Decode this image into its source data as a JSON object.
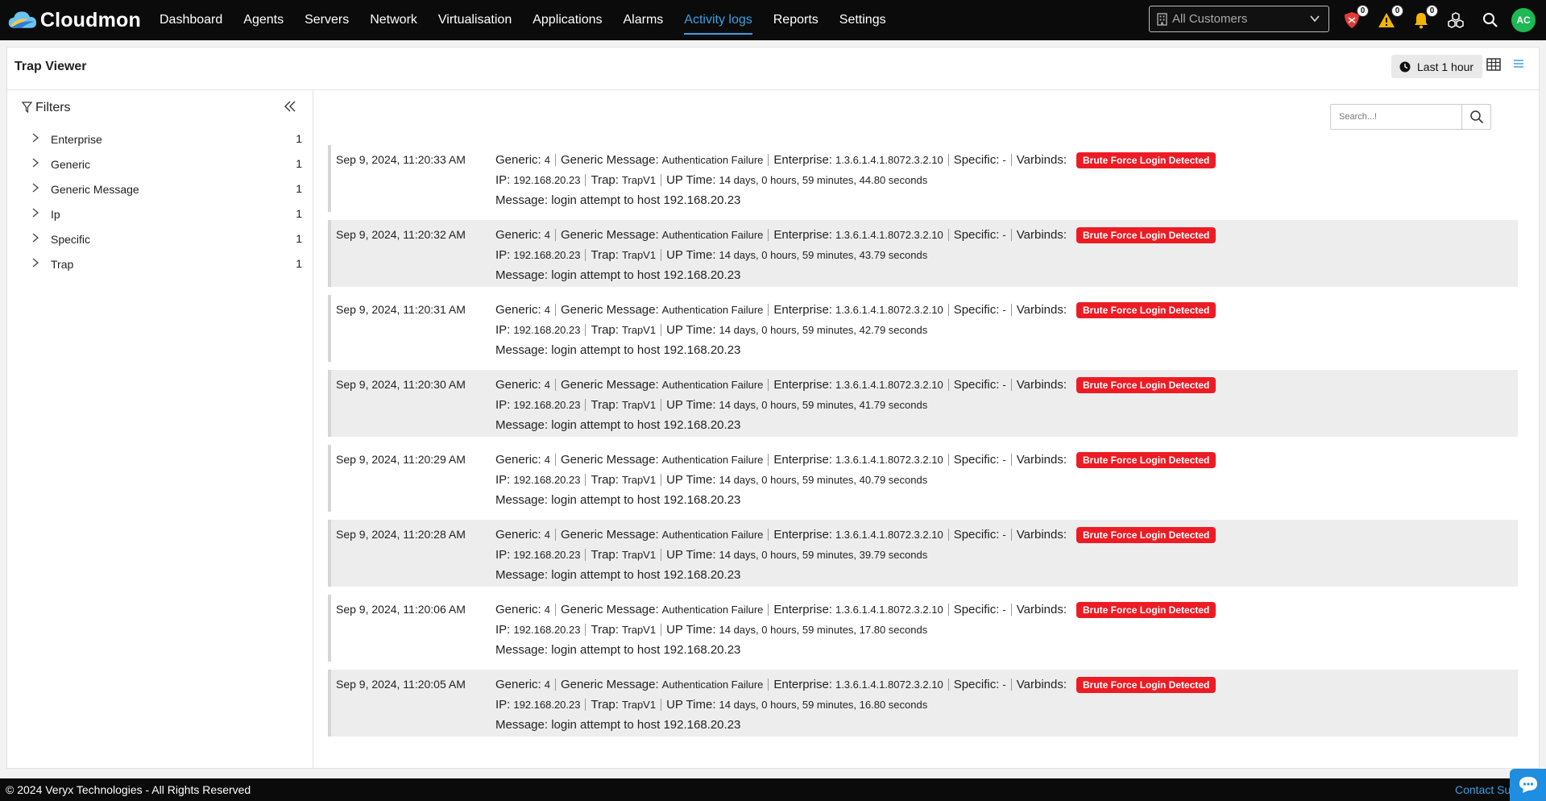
{
  "app": {
    "name": "Cloudmon"
  },
  "nav": [
    {
      "label": "Dashboard",
      "active": false
    },
    {
      "label": "Agents",
      "active": false
    },
    {
      "label": "Servers",
      "active": false
    },
    {
      "label": "Network",
      "active": false
    },
    {
      "label": "Virtualisation",
      "active": false
    },
    {
      "label": "Applications",
      "active": false
    },
    {
      "label": "Alarms",
      "active": false
    },
    {
      "label": "Activity logs",
      "active": true
    },
    {
      "label": "Reports",
      "active": false
    },
    {
      "label": "Settings",
      "active": false
    }
  ],
  "customer_select": {
    "placeholder": "All Customers"
  },
  "badges": {
    "security": "0",
    "warning": "0",
    "notifications": "0"
  },
  "user": {
    "initials": "AC"
  },
  "page": {
    "title": "Trap Viewer",
    "time_range": "Last 1 hour"
  },
  "filters": {
    "title": "Filters",
    "items": [
      {
        "label": "Enterprise",
        "count": "1"
      },
      {
        "label": "Generic",
        "count": "1"
      },
      {
        "label": "Generic Message",
        "count": "1"
      },
      {
        "label": "Ip",
        "count": "1"
      },
      {
        "label": "Specific",
        "count": "1"
      },
      {
        "label": "Trap",
        "count": "1"
      }
    ]
  },
  "search": {
    "placeholder": "Search...!"
  },
  "labels": {
    "generic": "Generic:",
    "generic_message": "Generic Message:",
    "enterprise": "Enterprise:",
    "specific": "Specific:",
    "varbinds": "Varbinds:",
    "ip": "IP:",
    "trap": "Trap:",
    "uptime": "UP Time:"
  },
  "logs": [
    {
      "timestamp": "Sep 9, 2024, 11:20:33 AM",
      "generic": "4",
      "generic_message": "Authentication Failure",
      "enterprise": "1.3.6.1.4.1.8072.3.2.10",
      "specific": "-",
      "varbind": "Brute Force Login Detected",
      "ip": "192.168.20.23",
      "trap": "TrapV1",
      "uptime": "14 days, 0 hours, 59 minutes, 44.80 seconds",
      "message": "Message: login attempt to host 192.168.20.23"
    },
    {
      "timestamp": "Sep 9, 2024, 11:20:32 AM",
      "generic": "4",
      "generic_message": "Authentication Failure",
      "enterprise": "1.3.6.1.4.1.8072.3.2.10",
      "specific": "-",
      "varbind": "Brute Force Login Detected",
      "ip": "192.168.20.23",
      "trap": "TrapV1",
      "uptime": "14 days, 0 hours, 59 minutes, 43.79 seconds",
      "message": "Message: login attempt to host 192.168.20.23"
    },
    {
      "timestamp": "Sep 9, 2024, 11:20:31 AM",
      "generic": "4",
      "generic_message": "Authentication Failure",
      "enterprise": "1.3.6.1.4.1.8072.3.2.10",
      "specific": "-",
      "varbind": "Brute Force Login Detected",
      "ip": "192.168.20.23",
      "trap": "TrapV1",
      "uptime": "14 days, 0 hours, 59 minutes, 42.79 seconds",
      "message": "Message: login attempt to host 192.168.20.23"
    },
    {
      "timestamp": "Sep 9, 2024, 11:20:30 AM",
      "generic": "4",
      "generic_message": "Authentication Failure",
      "enterprise": "1.3.6.1.4.1.8072.3.2.10",
      "specific": "-",
      "varbind": "Brute Force Login Detected",
      "ip": "192.168.20.23",
      "trap": "TrapV1",
      "uptime": "14 days, 0 hours, 59 minutes, 41.79 seconds",
      "message": "Message: login attempt to host 192.168.20.23"
    },
    {
      "timestamp": "Sep 9, 2024, 11:20:29 AM",
      "generic": "4",
      "generic_message": "Authentication Failure",
      "enterprise": "1.3.6.1.4.1.8072.3.2.10",
      "specific": "-",
      "varbind": "Brute Force Login Detected",
      "ip": "192.168.20.23",
      "trap": "TrapV1",
      "uptime": "14 days, 0 hours, 59 minutes, 40.79 seconds",
      "message": "Message: login attempt to host 192.168.20.23"
    },
    {
      "timestamp": "Sep 9, 2024, 11:20:28 AM",
      "generic": "4",
      "generic_message": "Authentication Failure",
      "enterprise": "1.3.6.1.4.1.8072.3.2.10",
      "specific": "-",
      "varbind": "Brute Force Login Detected",
      "ip": "192.168.20.23",
      "trap": "TrapV1",
      "uptime": "14 days, 0 hours, 59 minutes, 39.79 seconds",
      "message": "Message: login attempt to host 192.168.20.23"
    },
    {
      "timestamp": "Sep 9, 2024, 11:20:06 AM",
      "generic": "4",
      "generic_message": "Authentication Failure",
      "enterprise": "1.3.6.1.4.1.8072.3.2.10",
      "specific": "-",
      "varbind": "Brute Force Login Detected",
      "ip": "192.168.20.23",
      "trap": "TrapV1",
      "uptime": "14 days, 0 hours, 59 minutes, 17.80 seconds",
      "message": "Message: login attempt to host 192.168.20.23"
    },
    {
      "timestamp": "Sep 9, 2024, 11:20:05 AM",
      "generic": "4",
      "generic_message": "Authentication Failure",
      "enterprise": "1.3.6.1.4.1.8072.3.2.10",
      "specific": "-",
      "varbind": "Brute Force Login Detected",
      "ip": "192.168.20.23",
      "trap": "TrapV1",
      "uptime": "14 days, 0 hours, 59 minutes, 16.80 seconds",
      "message": "Message: login attempt to host 192.168.20.23"
    }
  ],
  "footer": {
    "copyright": "© 2024 Veryx Technologies - All Rights Reserved",
    "contact": "Contact Sup"
  },
  "colors": {
    "accent": "#3aa0e6",
    "danger": "#ed1c24",
    "avatar": "#1db954",
    "warning": "#f5b400"
  }
}
